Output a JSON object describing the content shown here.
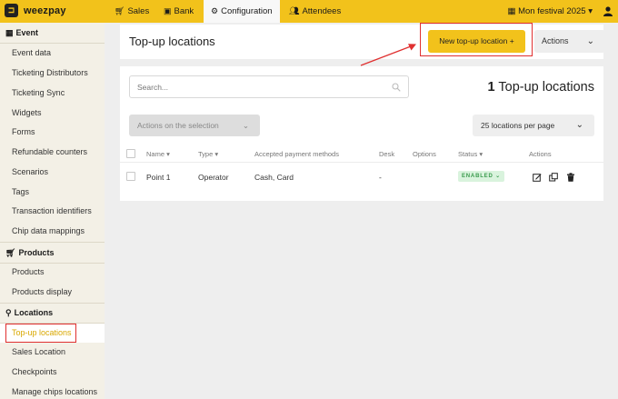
{
  "brand": {
    "logo_glyph": "⊐",
    "name": "weezpay"
  },
  "topnav": {
    "items": [
      {
        "label": "Sales",
        "icon": "cart-icon"
      },
      {
        "label": "Bank",
        "icon": "bank-icon"
      },
      {
        "label": "Configuration",
        "icon": "gear-icon"
      },
      {
        "label": "Attendees",
        "icon": "users-icon"
      }
    ],
    "festival": "Mon festival 2025",
    "festival_icon": "calendar-icon"
  },
  "sidebar": {
    "sections": [
      {
        "label": "Event",
        "icon": "calendar-icon"
      },
      {
        "label": "Products",
        "icon": "cart-icon"
      },
      {
        "label": "Locations",
        "icon": "map-pin-icon"
      }
    ],
    "event_items": [
      "Event data",
      "Ticketing Distributors",
      "Ticketing Sync",
      "Widgets",
      "Forms",
      "Refundable counters",
      "Scenarios",
      "Tags",
      "Transaction identifiers",
      "Chip data mappings"
    ],
    "product_items": [
      "Products",
      "Products display"
    ],
    "location_items": [
      "Top-up locations",
      "Sales Location",
      "Checkpoints",
      "Manage chips locations"
    ]
  },
  "header": {
    "title": "Top-up locations",
    "new_button": "New top-up location +",
    "actions_button": "Actions"
  },
  "toolbar": {
    "search_placeholder": "Search...",
    "count_number": "1",
    "count_label": "Top-up locations",
    "selection_button": "Actions on the selection",
    "per_page_button": "25 locations per page"
  },
  "table": {
    "headers": {
      "name": "Name ▾",
      "type": "Type ▾",
      "payment": "Accepted payment methods",
      "desk": "Desk",
      "options": "Options",
      "status": "Status ▾",
      "actions": "Actions"
    },
    "rows": [
      {
        "name": "Point 1",
        "type": "Operator",
        "payment": "Cash, Card",
        "desk": "-",
        "options": "",
        "status": "ENABLED ⌄"
      }
    ]
  },
  "colors": {
    "accent": "#f2c21b",
    "annotation": "#e03030",
    "status_enabled": "#3b9b4e"
  }
}
